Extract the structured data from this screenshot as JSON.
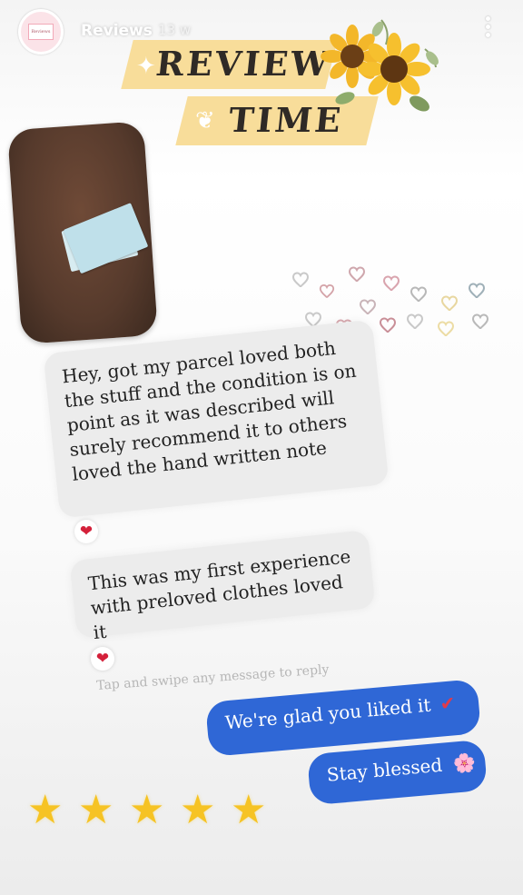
{
  "header": {
    "account_name": "Reviews",
    "time_ago": "13 w",
    "avatar_text": "Reviews",
    "more_icon": "more-vertical-icon"
  },
  "title": {
    "line1": "REVIEW",
    "line2": "TIME"
  },
  "messages": [
    {
      "text": "Hey, got my parcel loved both the stuff and the condition is on point as it was described will surely recommend it to others loved the hand written note",
      "reaction": "❤"
    },
    {
      "text": "This was my first experience with preloved clothes loved it",
      "reaction": "❤"
    }
  ],
  "reply_hint": "Tap and swipe any message to reply",
  "replies": [
    {
      "text": "We're glad you liked it",
      "emoji": "✔"
    },
    {
      "text": "Stay blessed",
      "emoji": "🌸"
    }
  ],
  "rating": {
    "stars_filled": 5,
    "stars_total": 5
  },
  "colors": {
    "banner": "#f8dd9a",
    "reply_bubble": "#2f67d6",
    "message_bubble": "#ececec",
    "star": "#f6c324",
    "heart": "#d4203a"
  }
}
